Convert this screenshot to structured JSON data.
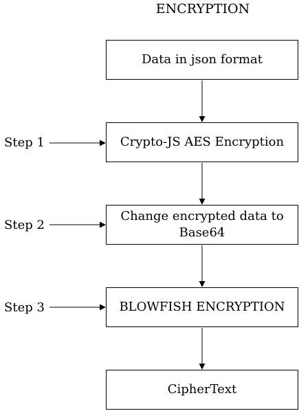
{
  "diagram": {
    "title": "ENCRYPTION",
    "boxes": [
      {
        "label": "Data in json format"
      },
      {
        "label": "Crypto-JS AES Encryption"
      },
      {
        "label": "Change encrypted data to Base64"
      },
      {
        "label": "BLOWFISH ENCRYPTION"
      },
      {
        "label": "CipherText"
      }
    ],
    "steps": [
      {
        "label": "Step 1"
      },
      {
        "label": "Step 2"
      },
      {
        "label": "Step 3"
      }
    ],
    "colors": {
      "line": "#000000",
      "background": "#ffffff"
    }
  }
}
